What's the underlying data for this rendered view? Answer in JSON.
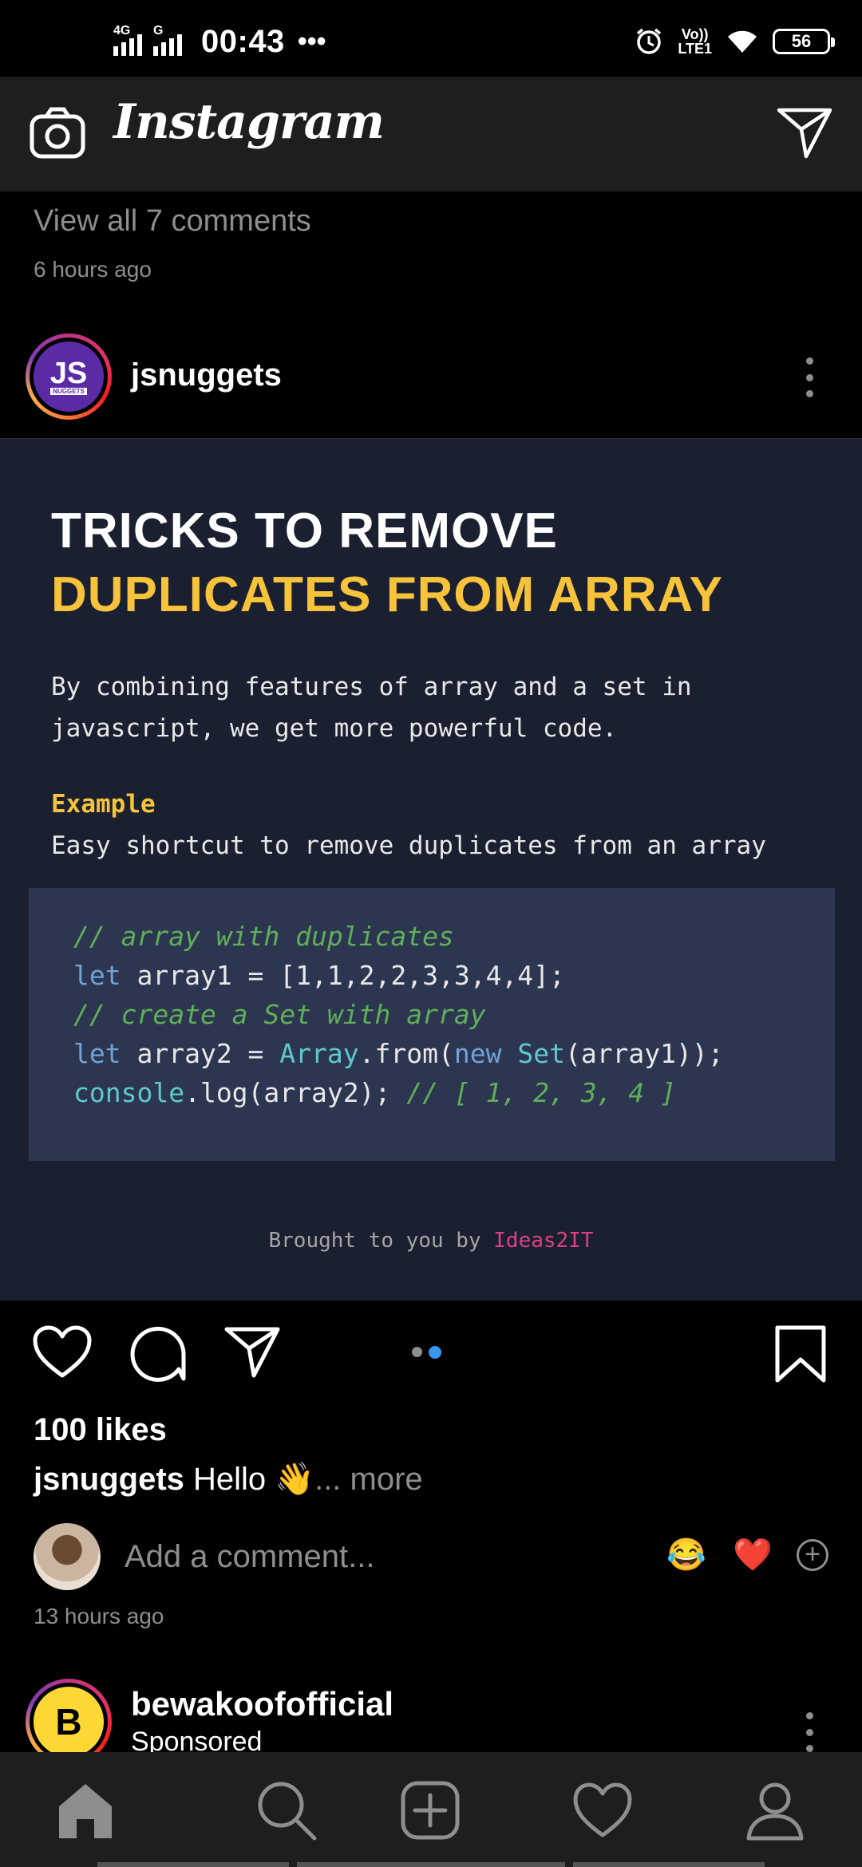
{
  "status_bar": {
    "network1": "4G",
    "network2": "G",
    "time": "00:43",
    "overflow": "•••",
    "volte_top": "Vo))",
    "volte_bottom": "LTE1",
    "battery": "56"
  },
  "app_bar": {
    "title": "Instagram",
    "camera_icon": "camera-icon",
    "direct_icon": "paper-plane-icon"
  },
  "prev_post": {
    "view_comments": "View all 7 comments",
    "time": "6 hours ago"
  },
  "post": {
    "username": "jsnuggets",
    "avatar_text": "JS",
    "avatar_sub": "NUGGETS",
    "image": {
      "title_line1": "TRICKS TO REMOVE",
      "title_line2": "DUPLICATES FROM ARRAY",
      "description": "By combining features of array and a set in javascript, we get more powerful code.",
      "example_label": "Example",
      "example_desc": "Easy shortcut to remove duplicates from an array",
      "code": {
        "line1_comment": "// array with duplicates",
        "line2_kw": "let",
        "line2_rest": " array1 = [1,1,2,2,3,3,4,4];",
        "line3_comment": "// create a Set with array",
        "line4_kw": "let",
        "line4_mid": " array2 = ",
        "line4_cls1": "Array",
        "line4_mid2": ".from(",
        "line4_kw2": "new",
        "line4_sp": " ",
        "line4_cls2": "Set",
        "line4_end": "(array1));",
        "line5_obj": "console",
        "line5_mid": ".log(array2); ",
        "line5_comment": "// [ 1, 2, 3, 4 ]"
      },
      "credit_prefix": "Brought to you by ",
      "credit_brand": "Ideas2IT"
    },
    "carousel_total": 2,
    "carousel_active": 2,
    "likes": "100 likes",
    "caption_user": "jsnuggets",
    "caption_text": " Hello 👋",
    "caption_more": "... more",
    "comment_placeholder": "Add a comment...",
    "quick_emoji1": "😂",
    "quick_emoji2": "❤️",
    "add_icon": "+",
    "time": "13 hours ago"
  },
  "next_post": {
    "username": "bewakoofofficial",
    "label": "Sponsored",
    "avatar_text": "B"
  },
  "bottom_nav": {
    "items": [
      "home-icon",
      "search-icon",
      "add-post-icon",
      "activity-heart-icon",
      "profile-icon"
    ]
  },
  "colors": {
    "accent_yellow": "#f7c33a",
    "brand_pink": "#e0407e",
    "dot_active": "#3897f0"
  }
}
